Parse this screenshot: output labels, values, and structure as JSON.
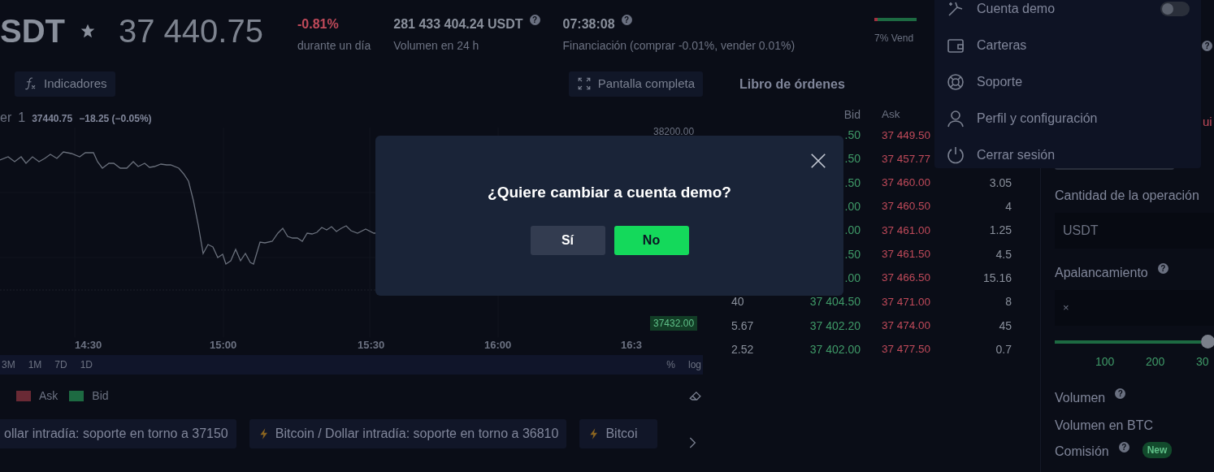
{
  "header": {
    "symbol": "SDT",
    "price": "37 440.75",
    "change": "-0.81%",
    "change_label": "durante un día",
    "volume": "281 433 404.24 USDT",
    "volume_help": "?",
    "volume_label": "Volumen en 24 h",
    "funding_time": "07:38:08",
    "funding_help": "?",
    "funding_label": "Financiación (comprar -0.01%, vender 0.01%)",
    "sentiment": {
      "label": "7% Vend",
      "level": 0.07
    },
    "corner_help": "?"
  },
  "chart": {
    "toolbar": [
      {
        "label": "Indicadores",
        "kind": "indicators"
      },
      {
        "label": "Pantalla completa",
        "kind": "fullscreen"
      }
    ],
    "legend": {
      "name": "er",
      "interval": "1",
      "last": "37440.75",
      "delta": "−18.25 (−0.05%)"
    },
    "price_labels": [
      {
        "text": "38200.00",
        "kind": "plain"
      },
      {
        "text": "37432.00",
        "kind": "bid"
      }
    ],
    "time_labels": [
      "14:30",
      "15:00",
      "15:30",
      "16:00",
      "16:3"
    ],
    "ranges": [
      "3M",
      "1M",
      "7D",
      "1D"
    ],
    "scale_options": [
      "%",
      "log"
    ]
  },
  "depth_legend": [
    {
      "label": "Ask",
      "color": "#6a2a35"
    },
    {
      "label": "Bid",
      "color": "#1d6a42"
    }
  ],
  "news": [
    {
      "text": "ollar intradía: soporte en torno a 37150",
      "icon": false
    },
    {
      "text": "Bitcoin / Dollar intradía: soporte en torno a 36810",
      "icon": true
    },
    {
      "text": "Bitcoi",
      "icon": true
    }
  ],
  "order_book": {
    "title": "Libro de órdenes",
    "columns": [
      "Bid",
      "Ask"
    ],
    "rows": [
      {
        "bid": ".50",
        "ask": "37 449.50"
      },
      {
        "bid": ".50",
        "ask": "37 457.77"
      },
      {
        "bid": ".50",
        "ask": "37 460.00",
        "total": "3.05"
      },
      {
        "bid": ".00",
        "ask": "37 460.50",
        "total": "4"
      },
      {
        "bid": ".00",
        "ask": "37 461.00",
        "total": "1.25"
      },
      {
        "bid": ".50",
        "ask": "37 461.50",
        "total": "4.5"
      },
      {
        "bid": ".00",
        "ask": "37 466.50",
        "total": "15.16"
      },
      {
        "amount": "40",
        "bid": "37 404.50",
        "ask": "37 471.00",
        "total": "8"
      },
      {
        "amount": "5.67",
        "bid": "37 402.20",
        "ask": "37 474.00",
        "total": "45"
      },
      {
        "amount": "2.52",
        "bid": "37 402.00",
        "ask": "37 477.50",
        "total": "0.7"
      }
    ]
  },
  "menu": {
    "items": [
      {
        "label": "Cuenta demo",
        "kind": "toggle",
        "on": false
      },
      {
        "label": "Carteras",
        "kind": "wallet"
      },
      {
        "label": "Soporte",
        "kind": "support"
      },
      {
        "label": "Perfil y configuración",
        "kind": "profile"
      },
      {
        "label": "Cerrar sesión",
        "kind": "power"
      }
    ]
  },
  "order_form": {
    "corner_text": "ui",
    "amount_label": "Cantidad de la operación",
    "amount_currency": "USDT",
    "leverage_label": "Apalancamiento",
    "leverage_help": "?",
    "leverage_prefix": "×",
    "leverage": {
      "level": 1.0
    },
    "ticks": [
      "100",
      "200",
      "30"
    ],
    "volume_label": "Volumen",
    "volume_help": "?",
    "volume_unit": "Volumen en BTC",
    "fee_label": "Comisión",
    "fee_help": "?",
    "fee_badge": "New"
  },
  "dialog": {
    "question": "¿Quiere cambiar a cuenta demo?",
    "buttons": [
      {
        "label": "Sí",
        "kind": "secondary"
      },
      {
        "label": "No",
        "kind": "primary"
      }
    ]
  }
}
